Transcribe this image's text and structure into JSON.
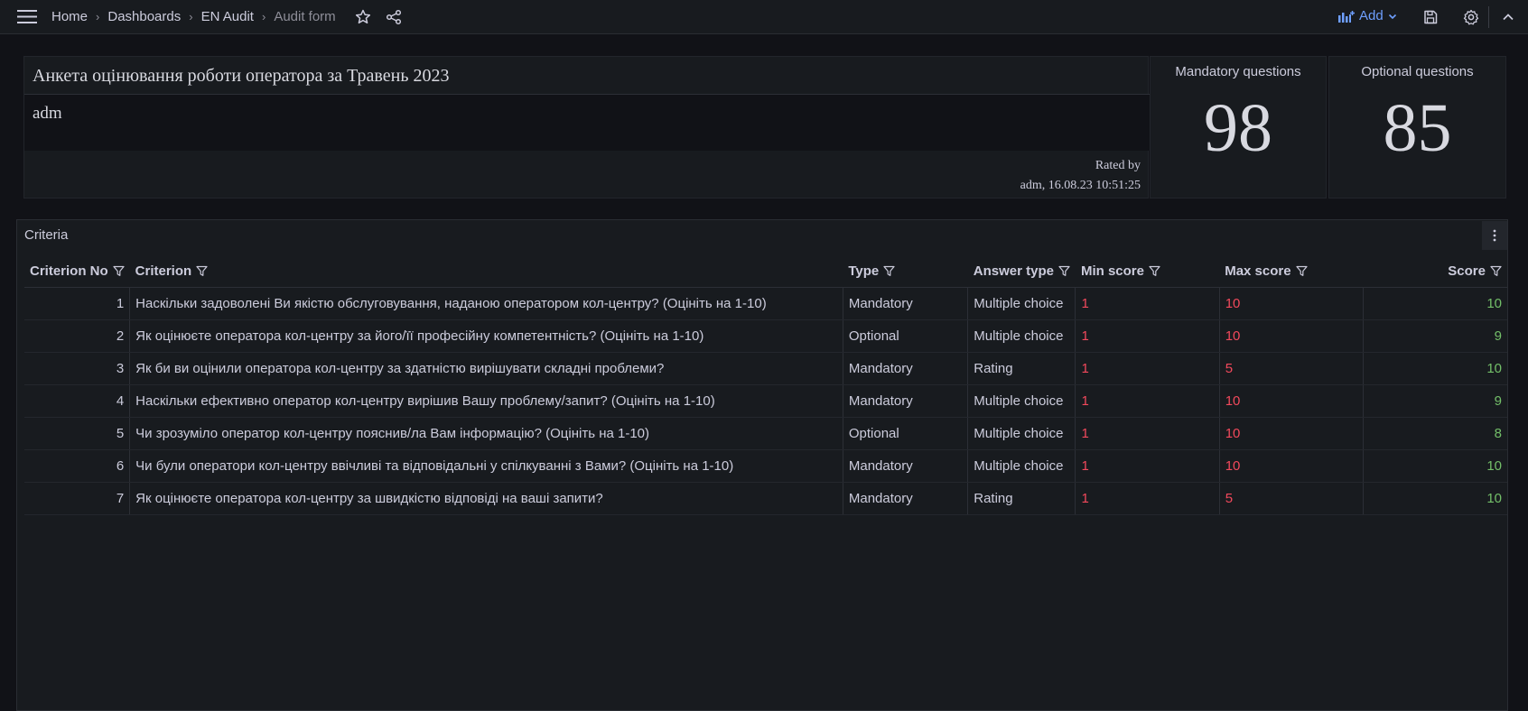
{
  "breadcrumb": [
    "Home",
    "Dashboards",
    "EN Audit"
  ],
  "breadcrumb_current": "Audit form",
  "toolbar": {
    "add_label": "Add"
  },
  "header": {
    "title": "Анкета оцінювання роботи оператора за Травень 2023",
    "user": "adm",
    "rated_by_label": "Rated by",
    "rated_by_value": "adm, 16.08.23 10:51:25"
  },
  "stats": {
    "mandatory": {
      "label": "Mandatory questions",
      "value": "98"
    },
    "optional": {
      "label": "Optional questions",
      "value": "85"
    }
  },
  "criteria": {
    "title": "Criteria",
    "columns": [
      "Criterion No",
      "Criterion",
      "Type",
      "Answer type",
      "Min score",
      "Max score",
      "Score"
    ],
    "rows": [
      {
        "no": "1",
        "criterion": "Наскільки задоволені Ви якістю обслуговування, наданою оператором кол-центру? (Оцініть на 1-10)",
        "type": "Mandatory",
        "answer_type": "Multiple choice",
        "min": "1",
        "max": "10",
        "score": "10"
      },
      {
        "no": "2",
        "criterion": "Як оцінюєте оператора кол-центру за його/її професійну компетентність? (Оцініть на 1-10)",
        "type": "Optional",
        "answer_type": "Multiple choice",
        "min": "1",
        "max": "10",
        "score": "9"
      },
      {
        "no": "3",
        "criterion": "Як би ви оцінили оператора кол-центру за здатністю вирішувати складні проблеми?",
        "type": "Mandatory",
        "answer_type": "Rating",
        "min": "1",
        "max": "5",
        "score": "10"
      },
      {
        "no": "4",
        "criterion": "Наскільки ефективно оператор кол-центру вирішив Вашу проблему/запит? (Оцініть на 1-10)",
        "type": "Mandatory",
        "answer_type": "Multiple choice",
        "min": "1",
        "max": "10",
        "score": "9"
      },
      {
        "no": "5",
        "criterion": "Чи зрозуміло оператор кол-центру пояснив/ла Вам інформацію? (Оцініть на 1-10)",
        "type": "Optional",
        "answer_type": "Multiple choice",
        "min": "1",
        "max": "10",
        "score": "8"
      },
      {
        "no": "6",
        "criterion": "Чи були оператори кол-центру ввічливі та відповідальні у спілкуванні з Вами? (Оцініть на 1-10)",
        "type": "Mandatory",
        "answer_type": "Multiple choice",
        "min": "1",
        "max": "10",
        "score": "10"
      },
      {
        "no": "7",
        "criterion": "Як оцінюєте оператора кол-центру за швидкістю відповіді на ваші запити?",
        "type": "Mandatory",
        "answer_type": "Rating",
        "min": "1",
        "max": "5",
        "score": "10"
      }
    ]
  },
  "colors": {
    "accent": "#6e9fff",
    "low": "#f2495c",
    "good": "#73bf69"
  }
}
